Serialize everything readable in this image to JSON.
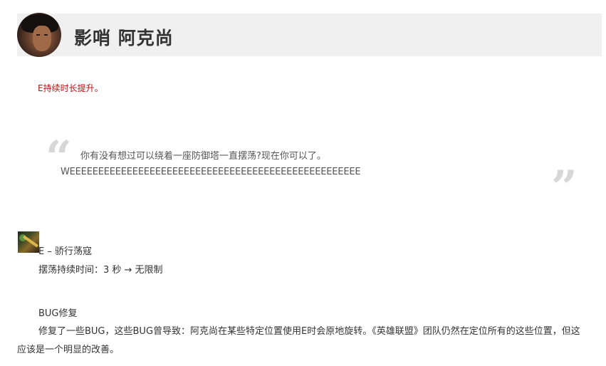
{
  "champion": {
    "name": "影哨 阿克尚"
  },
  "change_note": "E持续时长提升。",
  "quote": {
    "open_mark": "“",
    "close_mark": "”",
    "line1": "你有没有想过可以绕着一座防御塔一直摆荡?现在你可以了。",
    "line2": "WEEEEEEEEEEEEEEEEEEEEEEEEEEEEEEEEEEEEEEEEEEEEEEEEEEE"
  },
  "ability": {
    "icon": "ability-e-icon",
    "title": "E – 骄行荡寇",
    "detail": "摆荡持续时间：3 秒 → 无限制"
  },
  "bugfix": {
    "heading": "BUG修复",
    "text": "修复了一些BUG，这些BUG曾导致：阿克尚在某些特定位置使用E时会原地旋转。《英雄联盟》团队仍然在定位所有的这些位置，但这应该是一个明显的改善。"
  },
  "colors": {
    "accent_red": "#b31212",
    "header_bg": "#f0f0f0",
    "quote_mark": "#d7d7d7"
  }
}
